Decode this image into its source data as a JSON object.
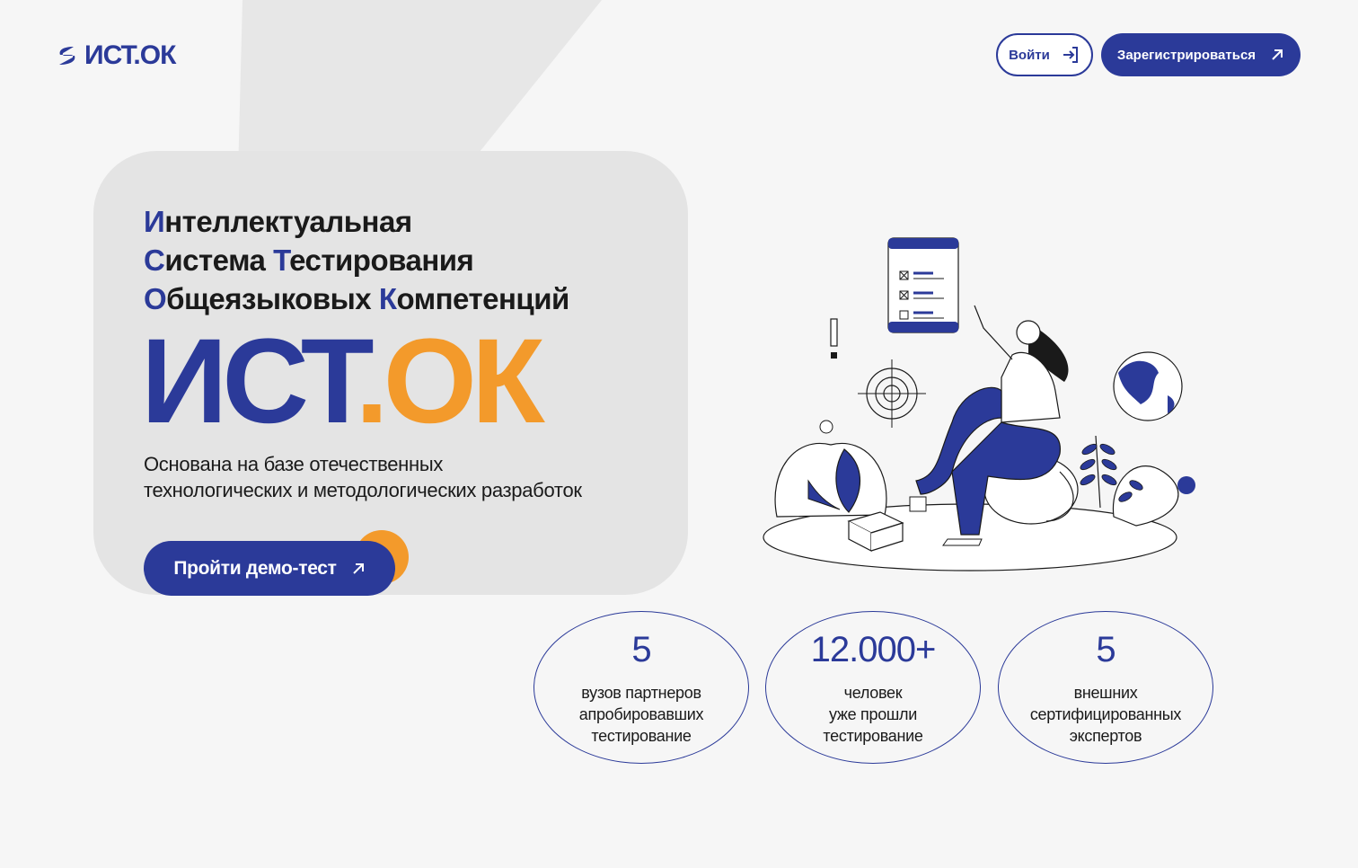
{
  "colors": {
    "brand_blue": "#2b3a99",
    "brand_orange": "#f39a2b",
    "background": "#f6f6f6"
  },
  "header": {
    "logo_text": "ИСТ.ОК",
    "login_label": "Войти",
    "register_label": "Зарегистрироваться"
  },
  "hero": {
    "headline": [
      {
        "first": "И",
        "rest": "нтеллектуальная"
      },
      {
        "first": "С",
        "rest": "истема ",
        "first2": "Т",
        "rest2": "естирования"
      },
      {
        "first": "О",
        "rest": "бщеязыковых ",
        "first2": "К",
        "rest2": "омпетенций"
      }
    ],
    "brand_blue_part": "ИСТ",
    "brand_orange_part": ".ОК",
    "subtitle_line1": "Основана на базе отечественных",
    "subtitle_line2": "технологических и методологических разработок",
    "demo_label": "Пройти демо-тест"
  },
  "stats": [
    {
      "value": "5",
      "label": "вузов партнеров\nапробировавших\nтестирование"
    },
    {
      "value": "12.000+",
      "label": "человек\nуже прошли\nтестирование"
    },
    {
      "value": "5",
      "label": "внешних\nсертифицированных\nэкспертов"
    }
  ],
  "icons": {
    "logo": "s-swoosh-icon",
    "login": "login-arrow-icon",
    "register": "arrow-up-right-icon",
    "demo": "arrow-up-right-icon"
  }
}
